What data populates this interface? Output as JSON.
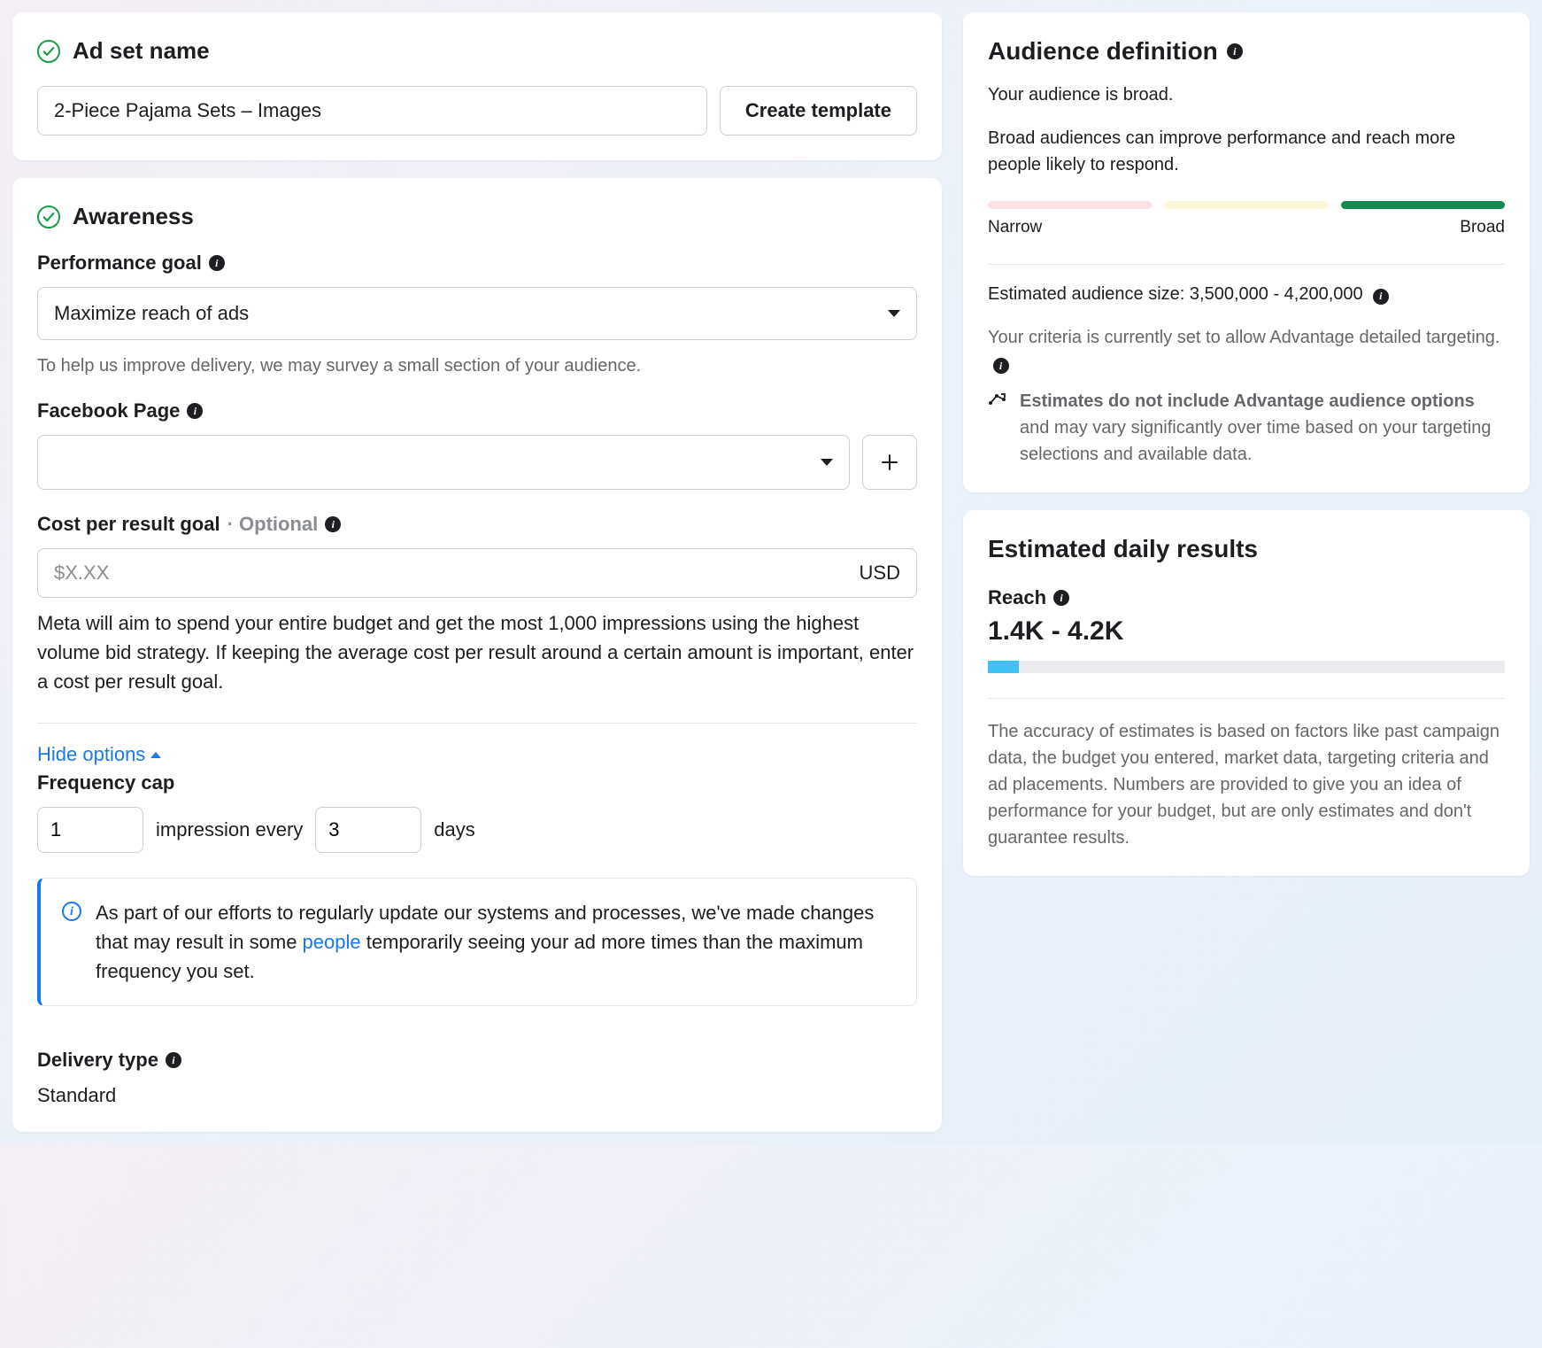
{
  "adset": {
    "sectionTitle": "Ad set name",
    "nameValue": "2-Piece Pajama Sets – Images",
    "createTemplateLabel": "Create template"
  },
  "awareness": {
    "sectionTitle": "Awareness",
    "perfGoalLabel": "Performance goal",
    "perfGoalValue": "Maximize reach of ads",
    "perfGoalHelp": "To help us improve delivery, we may survey a small section of your audience.",
    "fbPageLabel": "Facebook Page",
    "fbPageValue": "",
    "costLabel": "Cost per result goal",
    "optionalLabel": "· Optional",
    "costPlaceholder": "$X.XX",
    "costCurrency": "USD",
    "costHelp": "Meta will aim to spend your entire budget and get the most 1,000 impressions using the highest volume bid strategy. If keeping the average cost per result around a certain amount is important, enter a cost per result goal.",
    "hideOptionsLabel": "Hide options",
    "freqCapLabel": "Frequency cap",
    "freqImpressions": "1",
    "freqMiddle": "impression every",
    "freqDays": "3",
    "freqDaysLabel": "days",
    "bannerText1": "As part of our efforts to regularly update our systems and processes, we've made changes that may result in some ",
    "bannerLink": "people",
    "bannerText2": " temporarily seeing your ad more times than the maximum frequency you set.",
    "deliveryLabel": "Delivery type",
    "deliveryValue": "Standard"
  },
  "audience": {
    "title": "Audience definition",
    "broadLine": "Your audience is broad.",
    "broadDesc": "Broad audiences can improve performance and reach more people likely to respond.",
    "narrowLabel": "Narrow",
    "broadLabel": "Broad",
    "estSizeLabel": "Estimated audience size:",
    "estSizeValue": "3,500,000 - 4,200,000",
    "criteriaNote": "Your criteria is currently set to allow Advantage detailed targeting.",
    "estBold": "Estimates do not include Advantage audience options",
    "estRest": " and may vary significantly over time based on your targeting selections and available data."
  },
  "daily": {
    "title": "Estimated daily results",
    "reachLabel": "Reach",
    "reachValue": "1.4K - 4.2K",
    "disclaimer": "The accuracy of estimates is based on factors like past campaign data, the budget you entered, market data, targeting criteria and ad placements. Numbers are provided to give you an idea of performance for your budget, but are only estimates and don't guarantee results."
  }
}
